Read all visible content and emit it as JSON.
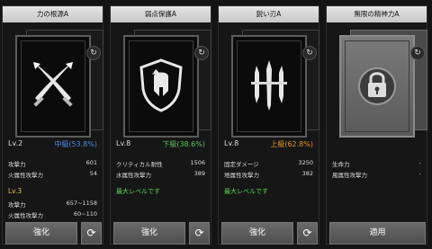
{
  "panels": [
    {
      "title": "力の根源A",
      "level": "Lv.2",
      "grade": "中級(53.8%)",
      "grade_color": "#4a8de8",
      "stats": [
        {
          "label": "攻撃力",
          "value": "601"
        },
        {
          "label": "火属性攻撃力",
          "value": "54"
        }
      ],
      "next_level": "Lv.3",
      "next_stats": [
        {
          "label": "攻撃力",
          "value": "657~1158"
        },
        {
          "label": "火属性攻撃力",
          "value": "60~110"
        }
      ],
      "button_label": "強化",
      "card_icon": "crossed-swords-icon"
    },
    {
      "title": "弱点保護A",
      "level": "Lv.8",
      "grade": "下級(38.6%)",
      "grade_color": "#5cc25c",
      "stats": [
        {
          "label": "クリティカル耐性",
          "value": "1506"
        },
        {
          "label": "水属性攻撃力",
          "value": "389"
        }
      ],
      "max_text": "最大レベルです",
      "button_label": "強化",
      "card_icon": "helmet-shield-icon"
    },
    {
      "title": "鋭い刃A",
      "level": "Lv.8",
      "grade": "上級(62.8%)",
      "grade_color": "#e8922a",
      "stats": [
        {
          "label": "固定ダメージ",
          "value": "3250"
        },
        {
          "label": "地属性攻撃力",
          "value": "382"
        }
      ],
      "max_text": "最大レベルです",
      "button_label": "強化",
      "card_icon": "triple-blade-icon"
    },
    {
      "title": "無限の精神力A",
      "stats": [
        {
          "label": "生命力",
          "value": "-"
        },
        {
          "label": "風属性攻撃力",
          "value": "-"
        }
      ],
      "button_label": "適用",
      "card_icon": "padlock-icon"
    }
  ],
  "icons": {
    "rotate": "rotate-icon",
    "refresh": "refresh-icon"
  }
}
